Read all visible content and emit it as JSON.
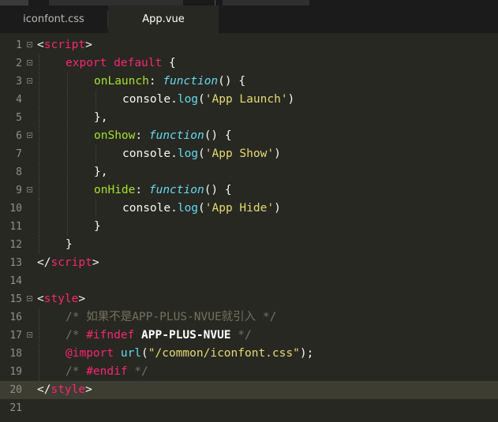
{
  "tabs": [
    {
      "label": "iconfont.css",
      "active": false
    },
    {
      "label": "App.vue",
      "active": true
    }
  ],
  "editor": {
    "current_line": 20,
    "lines": [
      {
        "n": "1",
        "fold": true,
        "indent": 0,
        "tokens": [
          {
            "c": "plain",
            "t": "<"
          },
          {
            "c": "tag",
            "t": "script"
          },
          {
            "c": "plain",
            "t": ">"
          }
        ]
      },
      {
        "n": "2",
        "fold": true,
        "indent": 1,
        "tokens": [
          {
            "c": "kw",
            "t": "export"
          },
          {
            "c": "plain",
            "t": " "
          },
          {
            "c": "kw",
            "t": "default"
          },
          {
            "c": "plain",
            "t": " {"
          }
        ]
      },
      {
        "n": "3",
        "fold": true,
        "indent": 2,
        "tokens": [
          {
            "c": "fn",
            "t": "onLaunch"
          },
          {
            "c": "plain",
            "t": ": "
          },
          {
            "c": "func",
            "t": "function"
          },
          {
            "c": "plain",
            "t": "() {"
          }
        ]
      },
      {
        "n": "4",
        "fold": false,
        "indent": 3,
        "tokens": [
          {
            "c": "plain",
            "t": "console."
          },
          {
            "c": "url",
            "t": "log"
          },
          {
            "c": "plain",
            "t": "("
          },
          {
            "c": "str",
            "t": "'App Launch'"
          },
          {
            "c": "plain",
            "t": ")"
          }
        ]
      },
      {
        "n": "5",
        "fold": false,
        "indent": 2,
        "tokens": [
          {
            "c": "plain",
            "t": "},"
          }
        ]
      },
      {
        "n": "6",
        "fold": true,
        "indent": 2,
        "tokens": [
          {
            "c": "fn",
            "t": "onShow"
          },
          {
            "c": "plain",
            "t": ": "
          },
          {
            "c": "func",
            "t": "function"
          },
          {
            "c": "plain",
            "t": "() {"
          }
        ]
      },
      {
        "n": "7",
        "fold": false,
        "indent": 3,
        "tokens": [
          {
            "c": "plain",
            "t": "console."
          },
          {
            "c": "url",
            "t": "log"
          },
          {
            "c": "plain",
            "t": "("
          },
          {
            "c": "str",
            "t": "'App Show'"
          },
          {
            "c": "plain",
            "t": ")"
          }
        ]
      },
      {
        "n": "8",
        "fold": false,
        "indent": 2,
        "tokens": [
          {
            "c": "plain",
            "t": "},"
          }
        ]
      },
      {
        "n": "9",
        "fold": true,
        "indent": 2,
        "tokens": [
          {
            "c": "fn",
            "t": "onHide"
          },
          {
            "c": "plain",
            "t": ": "
          },
          {
            "c": "func",
            "t": "function"
          },
          {
            "c": "plain",
            "t": "() {"
          }
        ]
      },
      {
        "n": "10",
        "fold": false,
        "indent": 3,
        "tokens": [
          {
            "c": "plain",
            "t": "console."
          },
          {
            "c": "url",
            "t": "log"
          },
          {
            "c": "plain",
            "t": "("
          },
          {
            "c": "str",
            "t": "'App Hide'"
          },
          {
            "c": "plain",
            "t": ")"
          }
        ]
      },
      {
        "n": "11",
        "fold": false,
        "indent": 2,
        "tokens": [
          {
            "c": "plain",
            "t": "}"
          }
        ]
      },
      {
        "n": "12",
        "fold": false,
        "indent": 1,
        "tokens": [
          {
            "c": "plain",
            "t": "}"
          }
        ]
      },
      {
        "n": "13",
        "fold": false,
        "indent": 0,
        "tokens": [
          {
            "c": "plain",
            "t": "</"
          },
          {
            "c": "tag",
            "t": "script"
          },
          {
            "c": "plain",
            "t": ">"
          }
        ]
      },
      {
        "n": "14",
        "fold": false,
        "indent": 0,
        "tokens": []
      },
      {
        "n": "15",
        "fold": true,
        "indent": 0,
        "tokens": [
          {
            "c": "plain",
            "t": "<"
          },
          {
            "c": "tag",
            "t": "style"
          },
          {
            "c": "plain",
            "t": ">"
          }
        ]
      },
      {
        "n": "16",
        "fold": false,
        "indent": 1,
        "tokens": [
          {
            "c": "cmt",
            "t": "/* 如果不是APP-PLUS-NVUE就引入 */"
          }
        ]
      },
      {
        "n": "17",
        "fold": true,
        "indent": 1,
        "tokens": [
          {
            "c": "cmt",
            "t": "/* "
          },
          {
            "c": "kw",
            "t": "#ifndef"
          },
          {
            "c": "plain",
            "t": " "
          },
          {
            "c": "bold",
            "t": "APP-PLUS-NVUE"
          },
          {
            "c": "cmt",
            "t": " */"
          }
        ]
      },
      {
        "n": "18",
        "fold": false,
        "indent": 1,
        "tokens": [
          {
            "c": "kw",
            "t": "@import"
          },
          {
            "c": "plain",
            "t": " "
          },
          {
            "c": "url",
            "t": "url"
          },
          {
            "c": "plain",
            "t": "("
          },
          {
            "c": "str",
            "t": "\"/common/iconfont.css\""
          },
          {
            "c": "plain",
            "t": ");"
          }
        ]
      },
      {
        "n": "19",
        "fold": false,
        "indent": 1,
        "tokens": [
          {
            "c": "cmt",
            "t": "/* "
          },
          {
            "c": "kw",
            "t": "#endif"
          },
          {
            "c": "cmt",
            "t": " */"
          }
        ]
      },
      {
        "n": "20",
        "fold": false,
        "indent": 0,
        "tokens": [
          {
            "c": "plain",
            "t": "</"
          },
          {
            "c": "tag",
            "t": "style"
          },
          {
            "c": "plain",
            "t": ">"
          }
        ]
      },
      {
        "n": "21",
        "fold": false,
        "indent": 0,
        "tokens": []
      }
    ]
  },
  "colors": {
    "background": "#272822",
    "tag": "#f92672",
    "string": "#e6db74",
    "function_name": "#a6e22e",
    "keyword_function": "#66d9ef",
    "comment": "#75715e",
    "current_line": "#3e3d32"
  }
}
